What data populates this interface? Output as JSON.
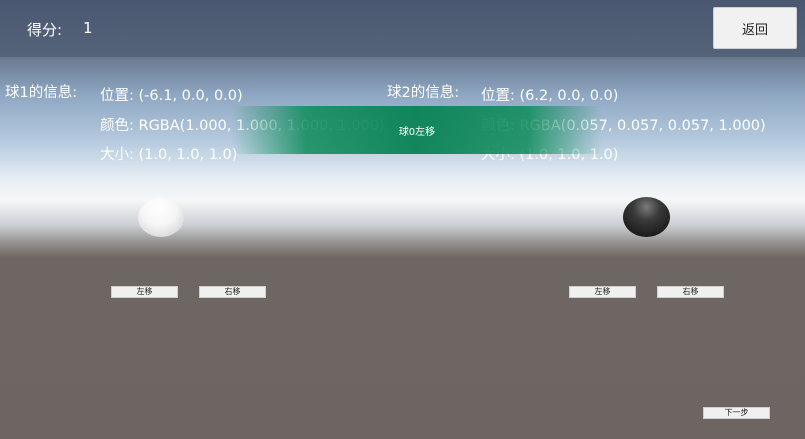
{
  "header": {
    "score_label": "得分:",
    "score_value": "1",
    "back_label": "返回"
  },
  "ball1": {
    "title": "球1的信息:",
    "position": "位置: (-6.1, 0.0, 0.0)",
    "color": "颜色: RGBA(1.000, 1.000, 1.000, 1.000)",
    "size": "大小: (1.0, 1.0, 1.0)",
    "left_label": "左移",
    "right_label": "右移"
  },
  "ball2": {
    "title": "球2的信息:",
    "position": "位置: (6.2, 0.0, 0.0)",
    "color": "颜色: RGBA(0.057, 0.057, 0.057, 1.000)",
    "size": "大小: (1.0, 1.0, 1.0)",
    "left_label": "左移",
    "right_label": "右移"
  },
  "toast": {
    "message": "球0左移"
  },
  "next_label": "下一步"
}
